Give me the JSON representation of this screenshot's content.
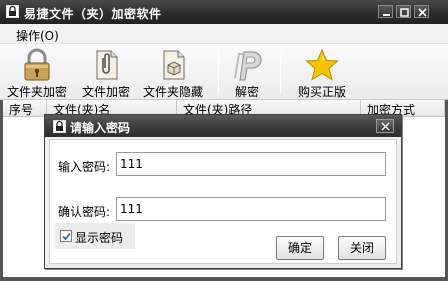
{
  "window": {
    "title": "易捷文件（夹）加密软件"
  },
  "menu": {
    "items": [
      {
        "label": "操作(O)"
      }
    ]
  },
  "toolbar": {
    "buttons": [
      {
        "label": "文件夹加密",
        "icon": "padlock-icon"
      },
      {
        "label": "文件加密",
        "icon": "document-clip-icon"
      },
      {
        "label": "文件夹隐藏",
        "icon": "box-document-icon"
      },
      {
        "label": "解密",
        "icon": "decrypt-p-icon"
      },
      {
        "label": "购买正版",
        "icon": "star-icon"
      }
    ]
  },
  "table": {
    "columns": [
      "序号",
      "文件(夹)名",
      "文件(夹)路径",
      "加密方式"
    ]
  },
  "dialog": {
    "title": "请输入密码",
    "password_label": "输入密码:",
    "password_value": "111",
    "confirm_label": "确认密码:",
    "confirm_value": "111",
    "show_password_label": "显示密码",
    "show_password_checked": true,
    "ok_label": "确定",
    "cancel_label": "关闭"
  }
}
